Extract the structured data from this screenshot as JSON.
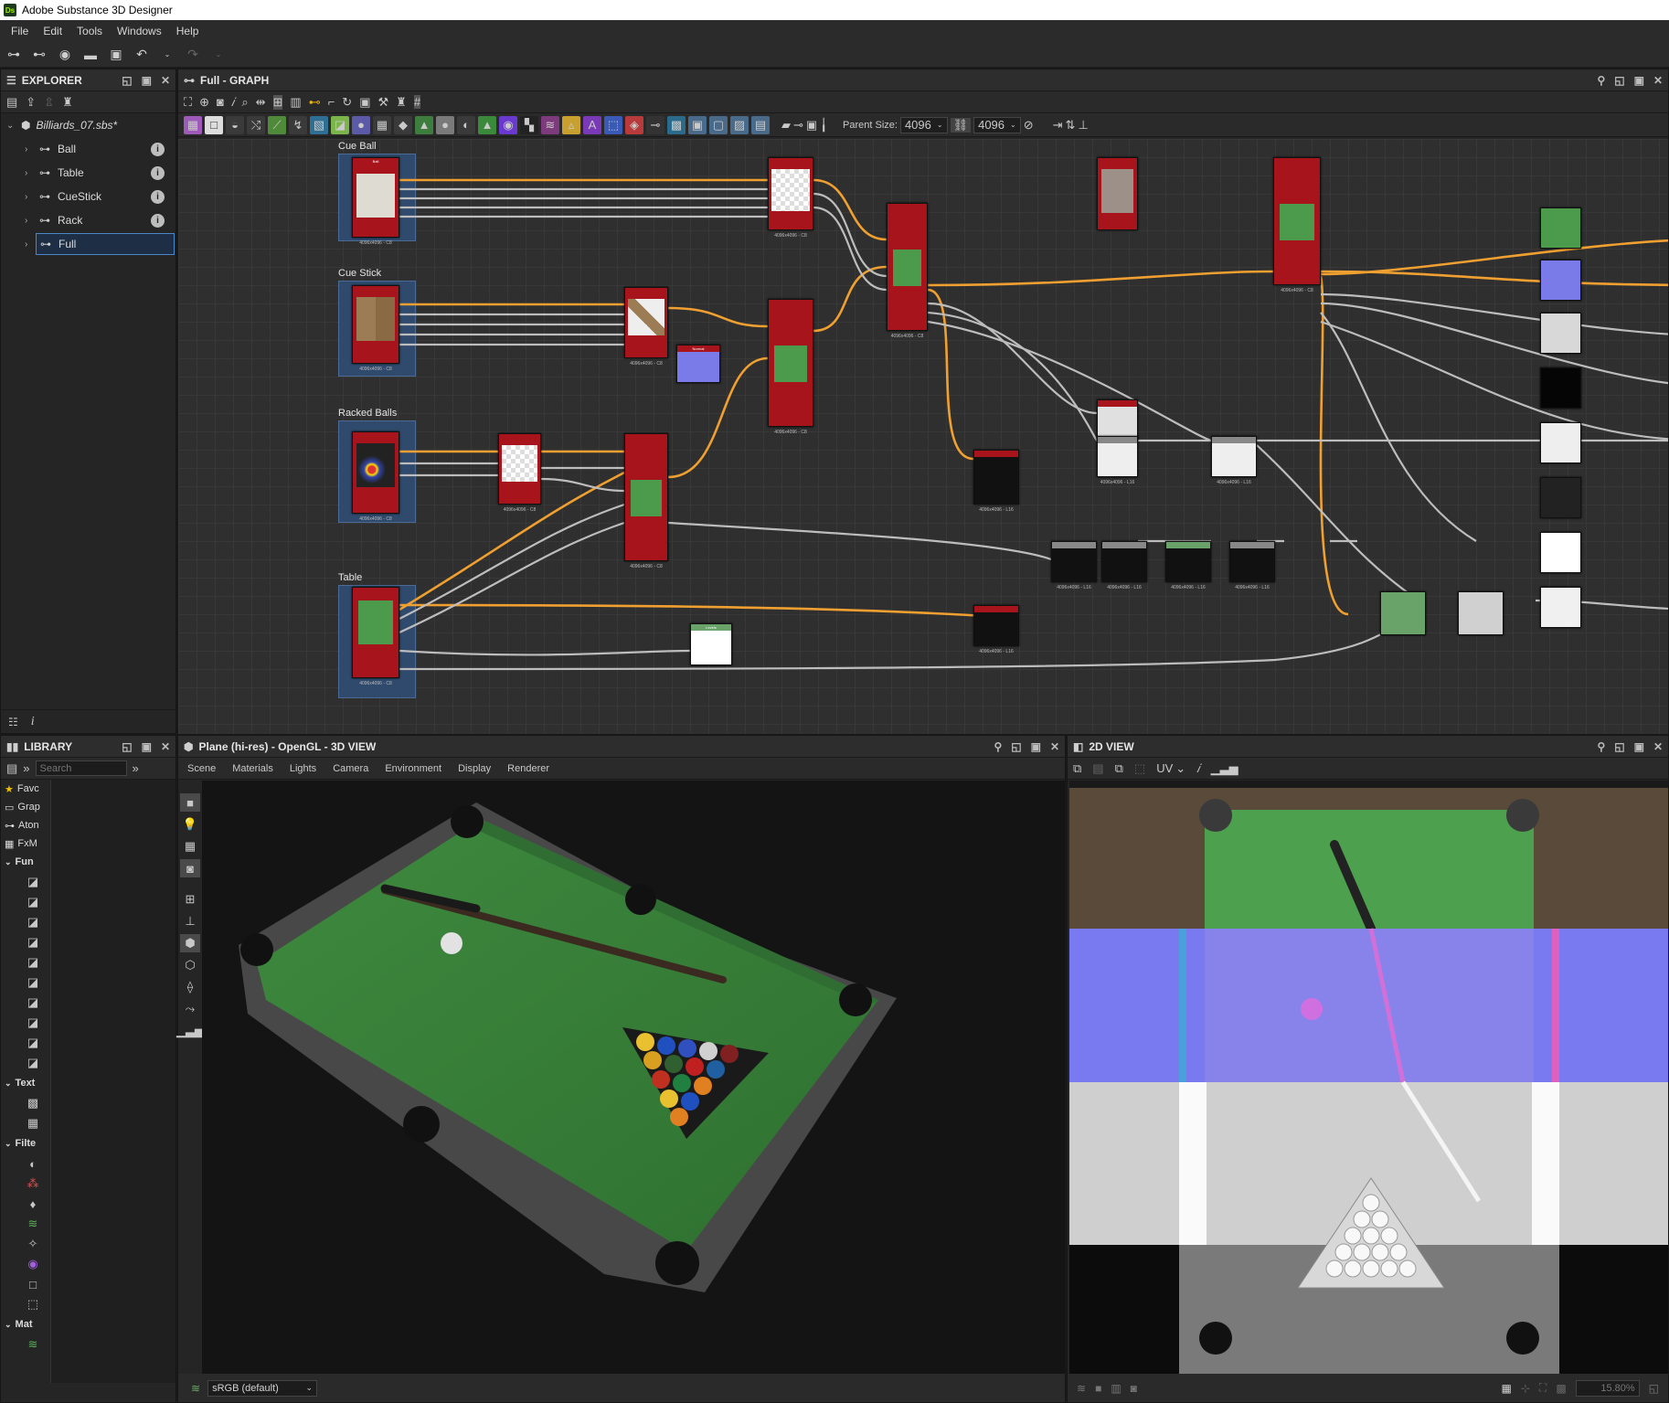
{
  "window": {
    "title": "Adobe Substance 3D Designer",
    "logo": "Ds"
  },
  "menu": [
    "File",
    "Edit",
    "Tools",
    "Windows",
    "Help"
  ],
  "explorer": {
    "title": "EXPLORER",
    "package": "Billiards_07.sbs*",
    "items": [
      {
        "label": "Ball"
      },
      {
        "label": "Table"
      },
      {
        "label": "CueStick"
      },
      {
        "label": "Rack"
      },
      {
        "label": "Full",
        "selected": true
      }
    ]
  },
  "graph": {
    "title": "Full - GRAPH",
    "parent_size_label": "Parent Size:",
    "width_value": "4096",
    "height_value": "4096",
    "frames": [
      "Cue Ball",
      "Cue Stick",
      "Racked Balls",
      "Table"
    ],
    "node_res": "4096x4096 - C8",
    "node_res_l16": "4096x4096 - L16"
  },
  "library": {
    "title": "LIBRARY",
    "search_placeholder": "Search",
    "categories": [
      {
        "label": "Favc",
        "icon": "star-icon"
      },
      {
        "label": "Grap",
        "icon": "graph-icon"
      },
      {
        "label": "Aton",
        "icon": "atomic-icon"
      },
      {
        "label": "FxM",
        "icon": "fxmap-icon"
      }
    ],
    "sections": [
      "Fun",
      "Text",
      "Filte",
      "Mat"
    ]
  },
  "view3d": {
    "title": "Plane (hi-res) - OpenGL - 3D VIEW",
    "menu": [
      "Scene",
      "Materials",
      "Lights",
      "Camera",
      "Environment",
      "Display",
      "Renderer"
    ],
    "color_space": "sRGB (default)"
  },
  "view2d": {
    "title": "2D VIEW",
    "uv_label": "UV",
    "zoom": "15.80%"
  },
  "colors": {
    "accent": "#ff9d00",
    "node_red": "#a8141c",
    "node_green": "#6aa36a",
    "frame_blue": "#2f4a6d"
  }
}
